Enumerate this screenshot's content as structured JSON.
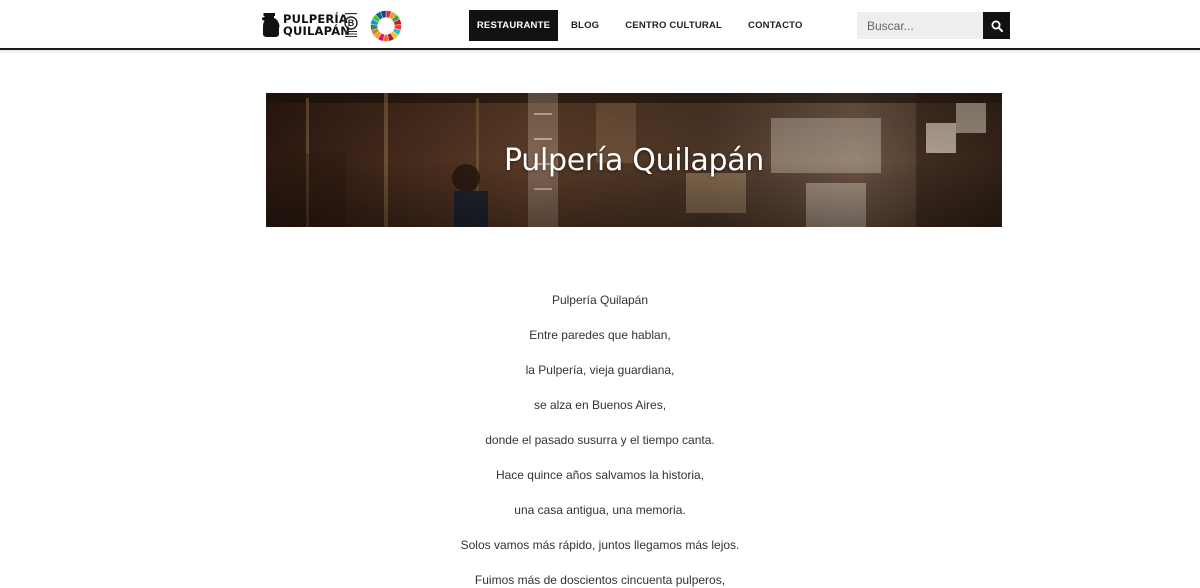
{
  "header": {
    "logo": {
      "line1": "PULPERÍA",
      "line2": "QUILAPÁN",
      "icon": "jug-icon"
    },
    "badges": [
      {
        "name": "b-corp-certified-badge",
        "text": "B"
      },
      {
        "name": "sdg-wheel-logo"
      }
    ],
    "nav": [
      {
        "label": "RESTAURANTE",
        "active": true
      },
      {
        "label": "BLOG",
        "active": false
      },
      {
        "label": "CENTRO CULTURAL",
        "active": false
      },
      {
        "label": "CONTACTO",
        "active": false
      }
    ],
    "search": {
      "placeholder": "Buscar...",
      "value": "",
      "icon": "search-icon"
    }
  },
  "hero": {
    "title": "Pulpería Quilapán"
  },
  "poem": {
    "lines": [
      "Pulpería Quilapán",
      "Entre paredes que hablan,",
      "la Pulpería, vieja guardiana,",
      "se alza en Buenos Aires,",
      "donde el pasado susurra y el tiempo canta.",
      "Hace quince años salvamos la historia,",
      "una casa antigua, una memoria.",
      "Solos vamos más rápido, juntos llegamos más lejos.",
      "Fuimos más de doscientos cincuenta pulperos,"
    ]
  },
  "colors": {
    "accent": "#111111",
    "nav_active_text": "#ffffff",
    "text": "#333333",
    "search_bg": "#eeeeee",
    "sdg_wheel": [
      "#e5243b",
      "#dda63a",
      "#4c9f38",
      "#c5192d",
      "#ff3a21",
      "#26bde2",
      "#fcc30b",
      "#a21942",
      "#fd6925",
      "#dd1367",
      "#fd9d24",
      "#bf8b2e",
      "#3f7e44",
      "#0a97d9",
      "#56c02b",
      "#00689d",
      "#19486a"
    ]
  }
}
